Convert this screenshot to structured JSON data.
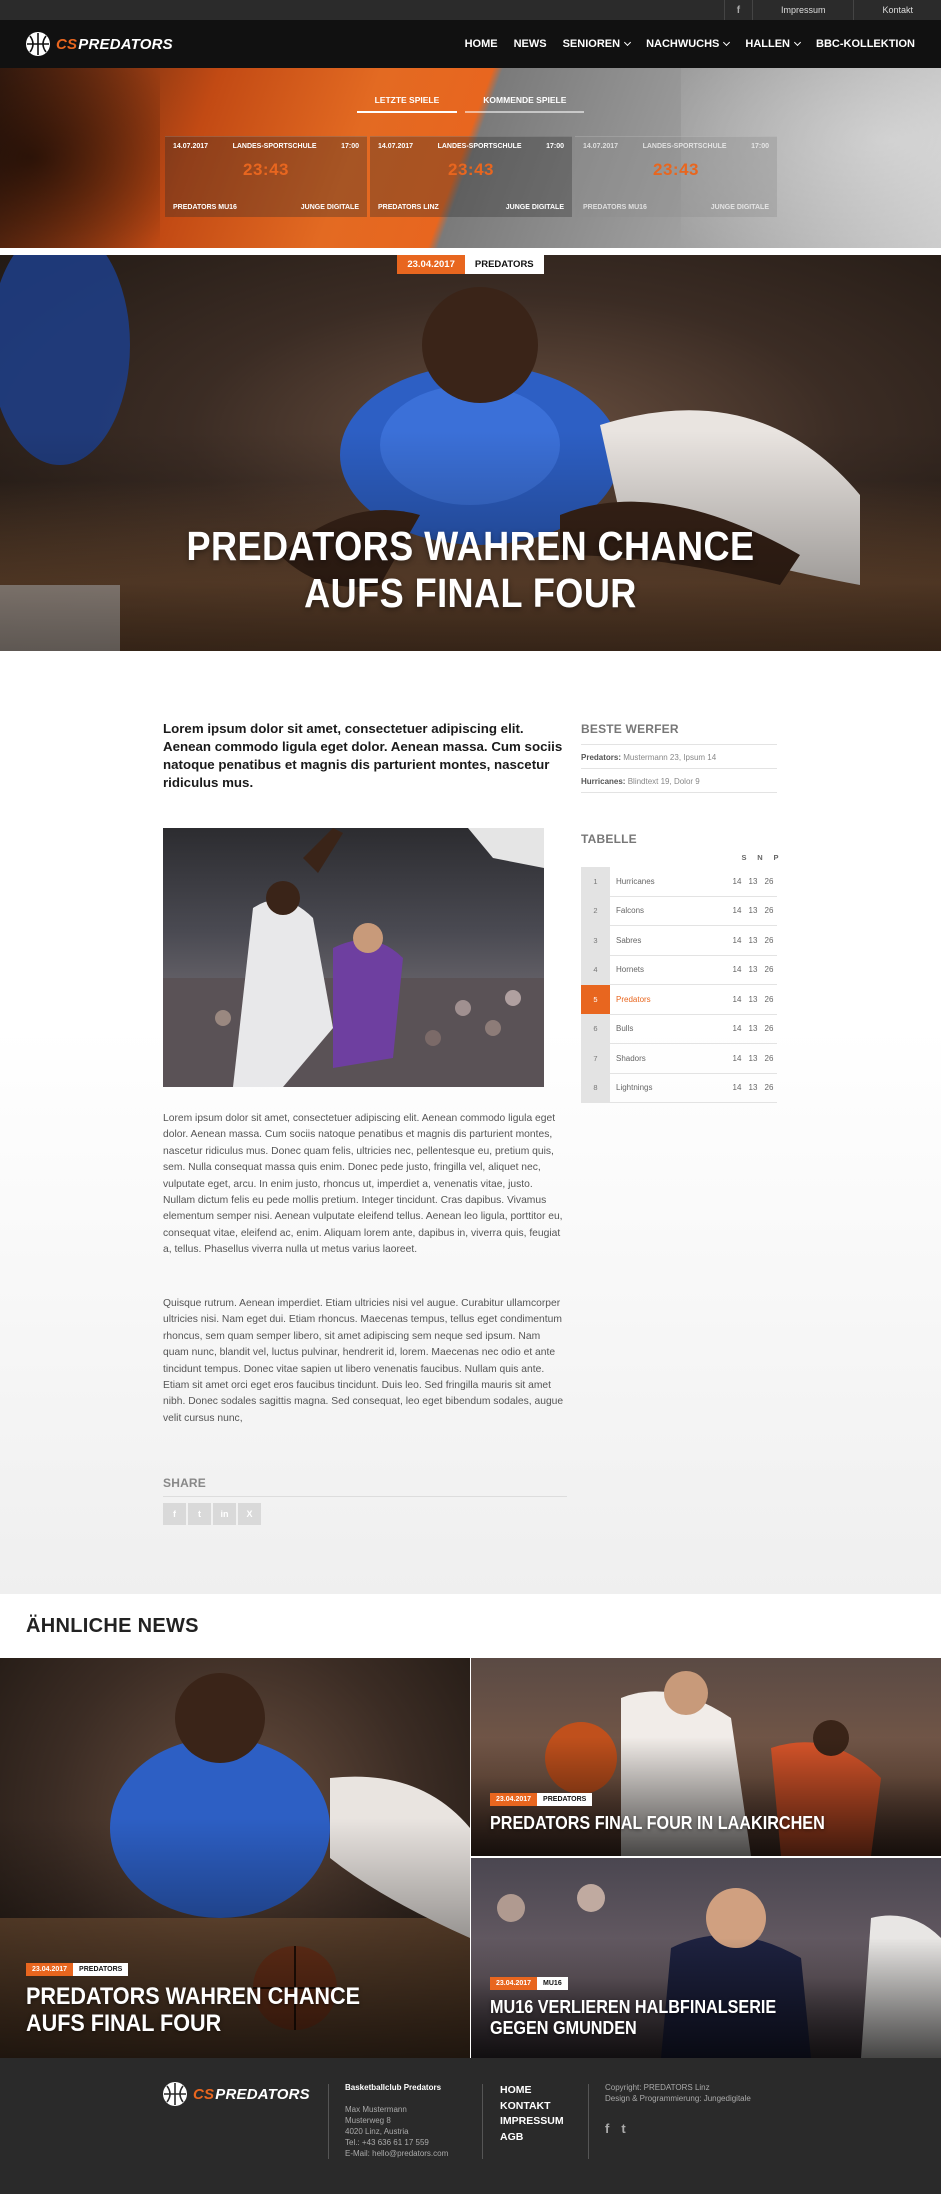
{
  "topbar": {
    "facebook_icon": "f",
    "links": [
      "Impressum",
      "Kontakt"
    ]
  },
  "brand": {
    "prefix": "CS",
    "name": "PREDATORS"
  },
  "nav": {
    "items": [
      {
        "label": "HOME",
        "dropdown": false
      },
      {
        "label": "NEWS",
        "dropdown": false
      },
      {
        "label": "SENIOREN",
        "dropdown": true
      },
      {
        "label": "NACHWUCHS",
        "dropdown": true
      },
      {
        "label": "HALLEN",
        "dropdown": true
      },
      {
        "label": "BBC-KOLLEKTION",
        "dropdown": false
      }
    ]
  },
  "scores": {
    "tabs": [
      "LETZTE SPIELE",
      "KOMMENDE SPIELE"
    ],
    "cards": [
      {
        "date": "14.07.2017",
        "venue": "LANDES-SPORTSCHULE",
        "time": "17:00",
        "score": "23:43",
        "home": "PREDATORS MU16",
        "away": "JUNGE DIGITALE"
      },
      {
        "date": "14.07.2017",
        "venue": "LANDES-SPORTSCHULE",
        "time": "17:00",
        "score": "23:43",
        "home": "PREDATORS LINZ",
        "away": "JUNGE DIGITALE"
      },
      {
        "date": "14.07.2017",
        "venue": "LANDES-SPORTSCHULE",
        "time": "17:00",
        "score": "23:43",
        "home": "PREDATORS MU16",
        "away": "JUNGE DIGITALE"
      }
    ]
  },
  "article": {
    "date": "23.04.2017",
    "category": "PREDATORS",
    "title_line1": "PREDATORS WAHREN CHANCE",
    "title_line2": "AUFS FINAL FOUR",
    "lead": "Lorem ipsum dolor sit amet, consectetuer adipiscing elit. Aenean commodo ligula eget dolor. Aenean massa. Cum sociis natoque penatibus et magnis dis parturient montes, nascetur ridiculus mus.",
    "paragraph1": "Lorem ipsum dolor sit amet, consectetuer adipiscing elit. Aenean commodo ligula eget dolor. Aenean massa. Cum sociis natoque penatibus et magnis dis parturient montes, nascetur ridiculus mus. Donec quam felis, ultricies nec, pellentesque eu, pretium quis, sem. Nulla consequat massa quis enim. Donec pede justo, fringilla vel, aliquet nec, vulputate eget, arcu. In enim justo, rhoncus ut, imperdiet a, venenatis vitae, justo. Nullam dictum felis eu pede mollis pretium. Integer tincidunt. Cras dapibus. Vivamus elementum semper nisi. Aenean vulputate eleifend tellus. Aenean leo ligula, porttitor eu, consequat vitae, eleifend ac, enim. Aliquam lorem ante, dapibus in, viverra quis, feugiat a, tellus. Phasellus viverra nulla ut metus varius laoreet.",
    "paragraph2": "Quisque rutrum. Aenean imperdiet. Etiam ultricies nisi vel augue. Curabitur ullamcorper ultricies nisi. Nam eget dui. Etiam rhoncus. Maecenas tempus, tellus eget condimentum rhoncus, sem quam semper libero, sit amet adipiscing sem neque sed ipsum. Nam quam nunc, blandit vel, luctus pulvinar, hendrerit id, lorem. Maecenas nec odio et ante tincidunt tempus. Donec vitae sapien ut libero venenatis faucibus. Nullam quis ante. Etiam sit amet orci eget eros faucibus tincidunt. Duis leo. Sed fringilla mauris sit amet nibh. Donec sodales sagittis magna. Sed consequat, leo eget bibendum sodales, augue velit cursus nunc,",
    "share_heading": "SHARE",
    "share_icons": [
      "f",
      "t",
      "in",
      "X"
    ]
  },
  "sidebar": {
    "werfer_heading": "BESTE WERFER",
    "werfer": [
      {
        "team": "Predators:",
        "players": "Mustermann 23, Ipsum 14"
      },
      {
        "team": "Hurricanes:",
        "players": "Blindtext 19, Dolor 9"
      }
    ],
    "table_heading": "TABELLE",
    "columns": [
      "S",
      "N",
      "P"
    ],
    "rows": [
      {
        "pos": "1",
        "team": "Hurricanes",
        "s": "14",
        "n": "13",
        "p": "26"
      },
      {
        "pos": "2",
        "team": "Falcons",
        "s": "14",
        "n": "13",
        "p": "26"
      },
      {
        "pos": "3",
        "team": "Sabres",
        "s": "14",
        "n": "13",
        "p": "26"
      },
      {
        "pos": "4",
        "team": "Hornets",
        "s": "14",
        "n": "13",
        "p": "26"
      },
      {
        "pos": "5",
        "team": "Predators",
        "s": "14",
        "n": "13",
        "p": "26",
        "highlight": true
      },
      {
        "pos": "6",
        "team": "Bulls",
        "s": "14",
        "n": "13",
        "p": "26"
      },
      {
        "pos": "7",
        "team": "Shadors",
        "s": "14",
        "n": "13",
        "p": "26"
      },
      {
        "pos": "8",
        "team": "Lightnings",
        "s": "14",
        "n": "13",
        "p": "26"
      }
    ]
  },
  "related": {
    "heading": "ÄHNLICHE NEWS",
    "items": [
      {
        "date": "23.04.2017",
        "category": "PREDATORS",
        "title_line1": "PREDATORS WAHREN CHANCE",
        "title_line2": "AUFS FINAL FOUR"
      },
      {
        "date": "23.04.2017",
        "category": "PREDATORS",
        "title_line1": "PREDATORS FINAL FOUR IN LAAKIRCHEN",
        "title_line2": ""
      },
      {
        "date": "23.04.2017",
        "category": "MU16",
        "title_line1": "MU16 VERLIEREN HALBFINALSERIE",
        "title_line2": "GEGEN GMUNDEN"
      }
    ]
  },
  "footer": {
    "club_title": "Basketballclub Predators",
    "address": [
      "Max Mustermann",
      "Musterweg 8",
      "4020 Linz, Austria",
      "Tel.: +43 636 61 17 559",
      "E-Mail: hello@predators.com"
    ],
    "links": [
      "HOME",
      "KONTAKT",
      "IMPRESSUM",
      "AGB"
    ],
    "copyright": "Copyright: PREDATORS Linz",
    "credits": "Design & Programmierung: Jungedigitale",
    "social": [
      "f",
      "t"
    ]
  },
  "colors": {
    "accent": "#e8661f",
    "dark": "#111111",
    "footer": "#2a2a2a"
  }
}
